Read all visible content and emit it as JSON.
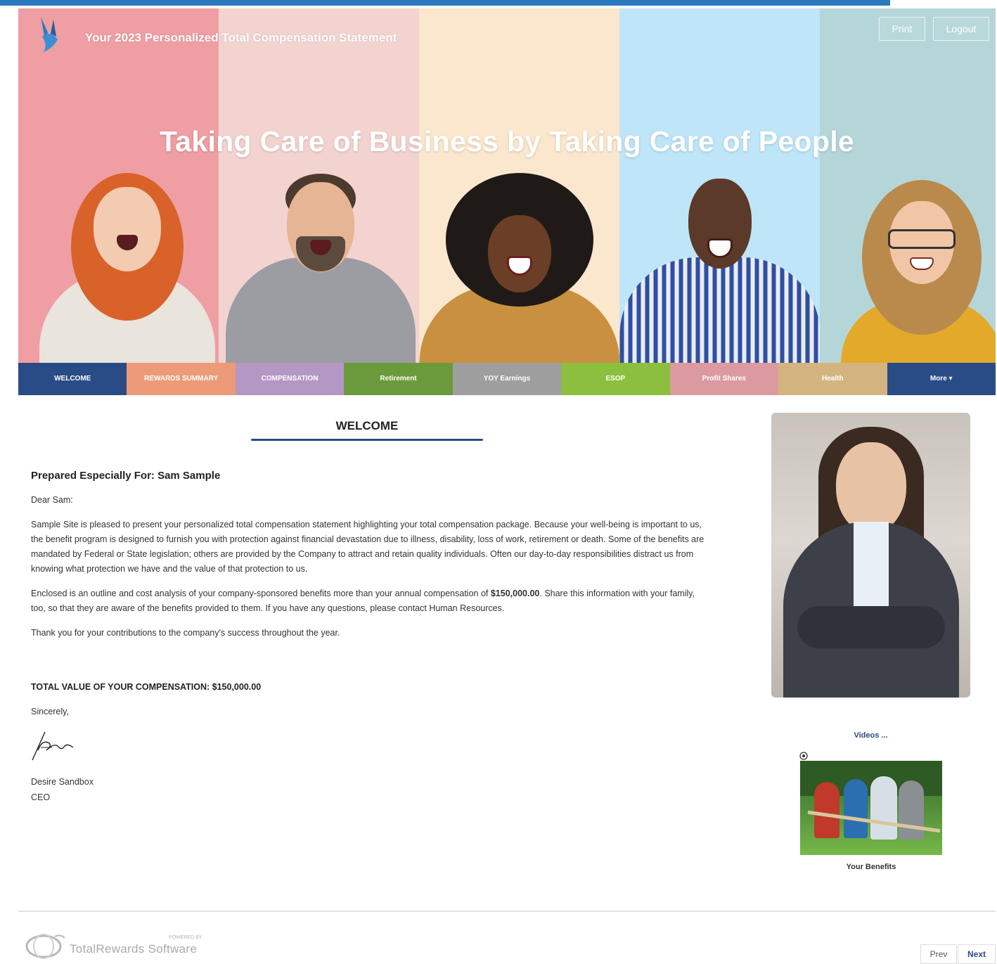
{
  "header": {
    "title": "Your 2023 Personalized Total Compensation Statement",
    "tagline": "Taking Care of Business by Taking Care of People",
    "print_label": "Print",
    "logout_label": "Logout"
  },
  "nav": {
    "tabs": [
      {
        "label": "WELCOME",
        "color": "#2a4c86"
      },
      {
        "label": "REWARDS SUMMARY",
        "color": "#ec9a77"
      },
      {
        "label": "COMPENSATION",
        "color": "#b497c5"
      },
      {
        "label": "Retirement",
        "color": "#6b9a3c"
      },
      {
        "label": "YOY Earnings",
        "color": "#9e9e9e"
      },
      {
        "label": "ESOP",
        "color": "#8dbf3e"
      },
      {
        "label": "Profit Shares",
        "color": "#dc9aa0"
      },
      {
        "label": "Health",
        "color": "#d4b47e"
      },
      {
        "label": "More ▾",
        "color": "#2a4c86"
      }
    ]
  },
  "main": {
    "heading": "WELCOME",
    "prepared_for": "Prepared Especially For: Sam Sample",
    "greeting": "Dear Sam:",
    "paragraph1": "Sample Site is pleased to present your personalized total compensation statement highlighting your total compensation package. Because your well-being is important to us, the benefit program is designed to furnish you with protection against financial devastation due to illness, disability, loss of work, retirement or death. Some of the benefits are mandated by Federal or State legislation; others are provided by the Company to attract and retain quality individuals. Often our day-to-day responsibilities distract us from knowing what protection we have and the value of that protection to us.",
    "paragraph2_before": "Enclosed is an outline and cost analysis of your company-sponsored benefits more than your annual compensation of ",
    "paragraph2_amount": "$150,000.00",
    "paragraph2_after": ". Share this information with your family, too, so that they are aware of the benefits provided to them. If you have any questions, please contact Human Resources.",
    "paragraph3": "Thank you for your contributions to the company's success throughout the year.",
    "total_value": "TOTAL VALUE OF YOUR COMPENSATION: $150,000.00",
    "closing": "Sincerely,",
    "signer_name": "Desire Sandbox",
    "signer_title": "CEO"
  },
  "sidebar": {
    "videos_link": "Videos ...",
    "video_caption": "Your Benefits"
  },
  "footer": {
    "powered_by": "POWERED BY",
    "brand": "TotalRewards Software",
    "prev_label": "Prev",
    "next_label": "Next"
  },
  "colors": {
    "accent": "#2a4c86",
    "top_stripe": "#2b7ac0"
  }
}
